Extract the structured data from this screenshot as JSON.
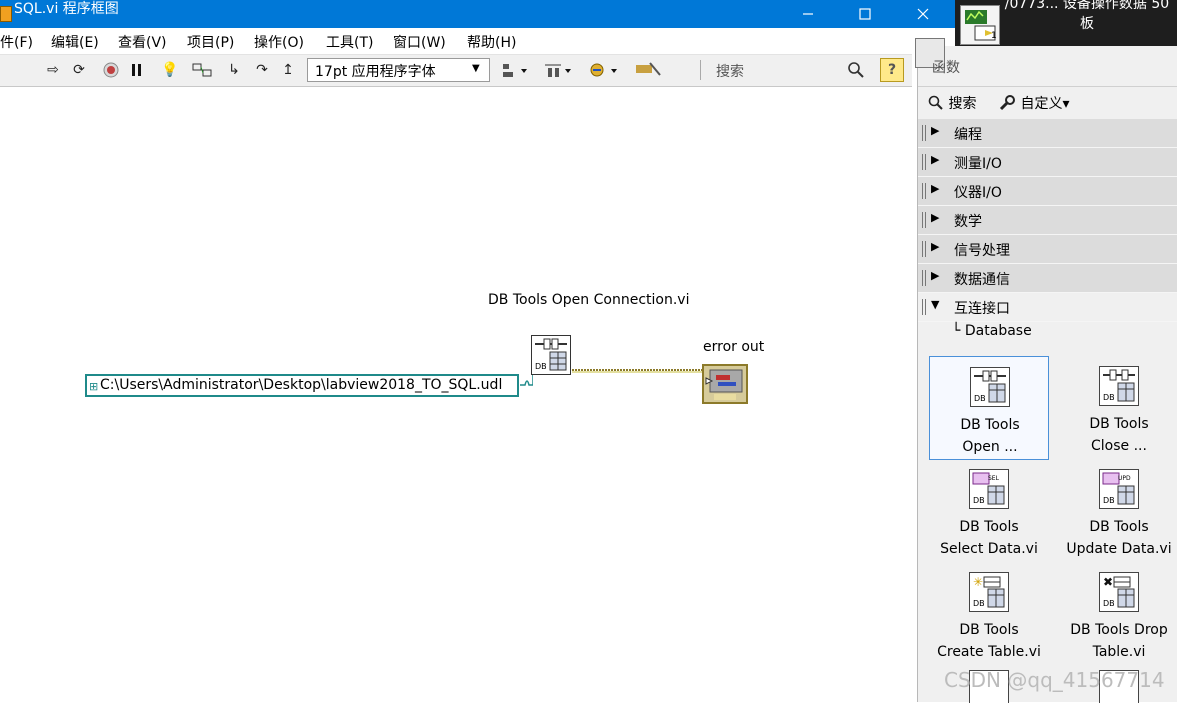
{
  "window": {
    "title": "SQL.vi 程序框图",
    "taskbar_thumb_text": "/0773... 设备操作数据 50 板"
  },
  "menu": [
    {
      "label": "件(F)"
    },
    {
      "label": "编辑(E)"
    },
    {
      "label": "查看(V)"
    },
    {
      "label": "项目(P)"
    },
    {
      "label": "操作(O)"
    },
    {
      "label": "工具(T)"
    },
    {
      "label": "窗口(W)"
    },
    {
      "label": "帮助(H)"
    }
  ],
  "toolbar": {
    "font_select": "17pt 应用程序字体",
    "search_placeholder": "搜索",
    "help_label": "?"
  },
  "diagram": {
    "vi_label": "DB Tools Open Connection.vi",
    "path_constant": "C:\\Users\\Administrator\\Desktop\\labview2018_TO_SQL.udl",
    "vi_node_badge": "DB",
    "error_out_label": "error out"
  },
  "palette": {
    "title": "函数",
    "search_label": "搜索",
    "customize_label": "自定义▾",
    "categories": [
      {
        "label": "编程",
        "expanded": false
      },
      {
        "label": "测量I/O",
        "expanded": false
      },
      {
        "label": "仪器I/O",
        "expanded": false
      },
      {
        "label": "数学",
        "expanded": false
      },
      {
        "label": "信号处理",
        "expanded": false
      },
      {
        "label": "数据通信",
        "expanded": false
      },
      {
        "label": "互连接口",
        "expanded": true
      }
    ],
    "subcategory": "Database",
    "items": [
      {
        "line1": "DB Tools",
        "line2": "Open ...",
        "badge": "DB",
        "selected": true
      },
      {
        "line1": "DB Tools",
        "line2": "Close ...",
        "badge": "DB",
        "selected": false
      },
      {
        "line1": "DB Tools",
        "line2": "Select Data.vi",
        "badge": "DB",
        "tag": "SEL"
      },
      {
        "line1": "DB Tools",
        "line2": "Update Data.vi",
        "badge": "DB",
        "tag": "UPD"
      },
      {
        "line1": "DB Tools",
        "line2": "Create Table.vi",
        "badge": "DB"
      },
      {
        "line1": "DB Tools Drop",
        "line2": "Table.vi",
        "badge": "DB"
      }
    ],
    "watermark": "CSDN @qq_41567714"
  },
  "colors": {
    "titlebar": "#0078d7",
    "path_wire": "#1f8a8a",
    "cluster_wire": "#8c7a2a",
    "selection": "#4a90d9"
  }
}
